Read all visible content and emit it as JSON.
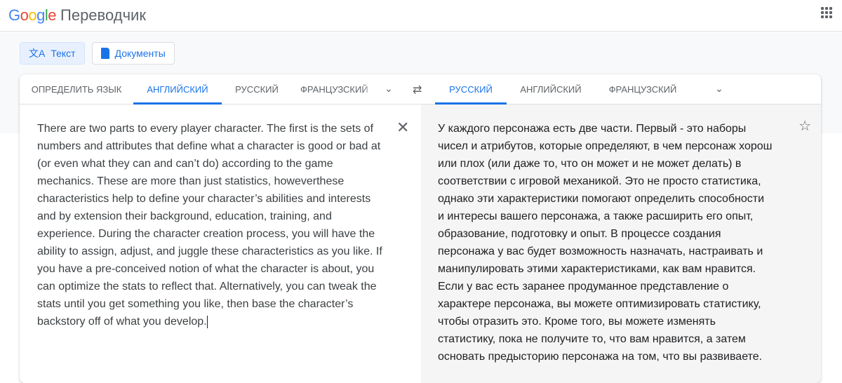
{
  "header": {
    "logo": "Google",
    "product": "Переводчик"
  },
  "modes": [
    {
      "label": "Текст",
      "icon": "translate-icon"
    },
    {
      "label": "Документы",
      "icon": "document-icon"
    }
  ],
  "source_tabs": [
    "Определить язык",
    "Английский",
    "Русский",
    "Французский"
  ],
  "target_tabs": [
    "Русский",
    "Английский",
    "Французский"
  ],
  "source_lines": [
    "There are two parts to every player character. The first is the sets of",
    "numbers and attributes that define what a character is good or bad at",
    "(or even what they can and can’t do) according to the game",
    "mechanics. These are more than just statistics, howeverthese",
    "characteristics help to define your character’s abilities and interests",
    "and by extension their background, education, training, and",
    "experience. During the character creation process, you will have the",
    "ability to assign, adjust, and juggle these characteristics as you like. If",
    "you have a pre-conceived notion of what the character is about, you",
    "can optimize the stats to reflect that. Alternatively, you can tweak the",
    "stats until you get something you like, then base the character’s",
    "backstory off of what you develop."
  ],
  "target_lines": [
    "У каждого персонажа есть две части. Первый - это наборы",
    "чисел и атрибутов, которые определяют, в чем персонаж хорош",
    "или плох (или даже то, что он может и не может делать) в",
    "соответствии с игровой механикой. Это не просто статистика,",
    "однако эти характеристики помогают определить способности",
    "и интересы вашего персонажа, а также расширить его опыт,",
    "образование, подготовку и опыт. В процессе создания",
    "персонажа у вас будет возможность назначать, настраивать и",
    "манипулировать этими характеристиками, как вам нравится.",
    "Если у вас есть заранее продуманное представление о",
    "характере персонажа, вы можете оптимизировать статистику,",
    "чтобы отразить это. Кроме того, вы можете изменять",
    "статистику, пока не получите то, что вам нравится, а затем",
    "основать предысторию персонажа на том, что вы развиваете."
  ]
}
